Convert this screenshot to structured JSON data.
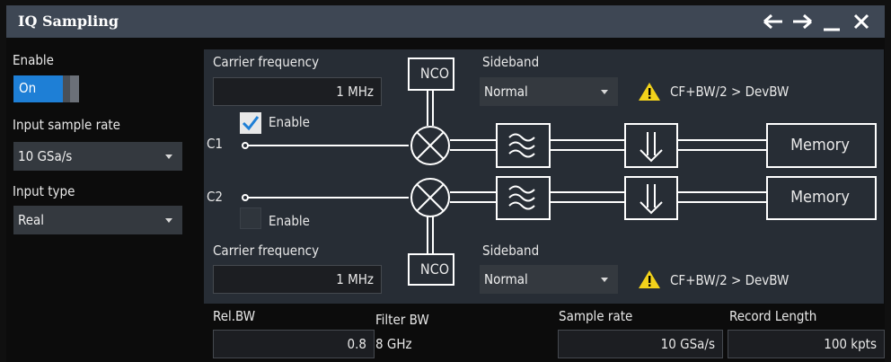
{
  "window": {
    "title": "IQ Sampling"
  },
  "left": {
    "enable_label": "Enable",
    "enable_toggle": "On",
    "sample_rate_label": "Input sample rate",
    "sample_rate_value": "10 GSa/s",
    "input_type_label": "Input type",
    "input_type_value": "Real"
  },
  "ch1": {
    "carrier_label": "Carrier frequency",
    "carrier_value": "1 MHz",
    "sideband_label": "Sideband",
    "sideband_value": "Normal",
    "warning": "CF+BW/2 > DevBW",
    "enable_label": "Enable",
    "enabled": true,
    "channel": "C1"
  },
  "ch2": {
    "carrier_label": "Carrier frequency",
    "carrier_value": "1 MHz",
    "sideband_label": "Sideband",
    "sideband_value": "Normal",
    "warning": "CF+BW/2 > DevBW",
    "enable_label": "Enable",
    "enabled": false,
    "channel": "C2"
  },
  "diagram": {
    "nco_label": "NCO",
    "memory_label": "Memory"
  },
  "bottom": {
    "relbw_label": "Rel.BW",
    "relbw_value": "0.8",
    "filterbw_label": "Filter BW",
    "filterbw_value": "8 GHz",
    "samplerate_label": "Sample rate",
    "samplerate_value": "10 GSa/s",
    "recordlength_label": "Record Length",
    "recordlength_value": "100 kpts"
  },
  "colors": {
    "accent": "#1e7fd6",
    "titlebar": "#3e4754",
    "panel": "#272d35",
    "warning": "#f2d21b"
  }
}
